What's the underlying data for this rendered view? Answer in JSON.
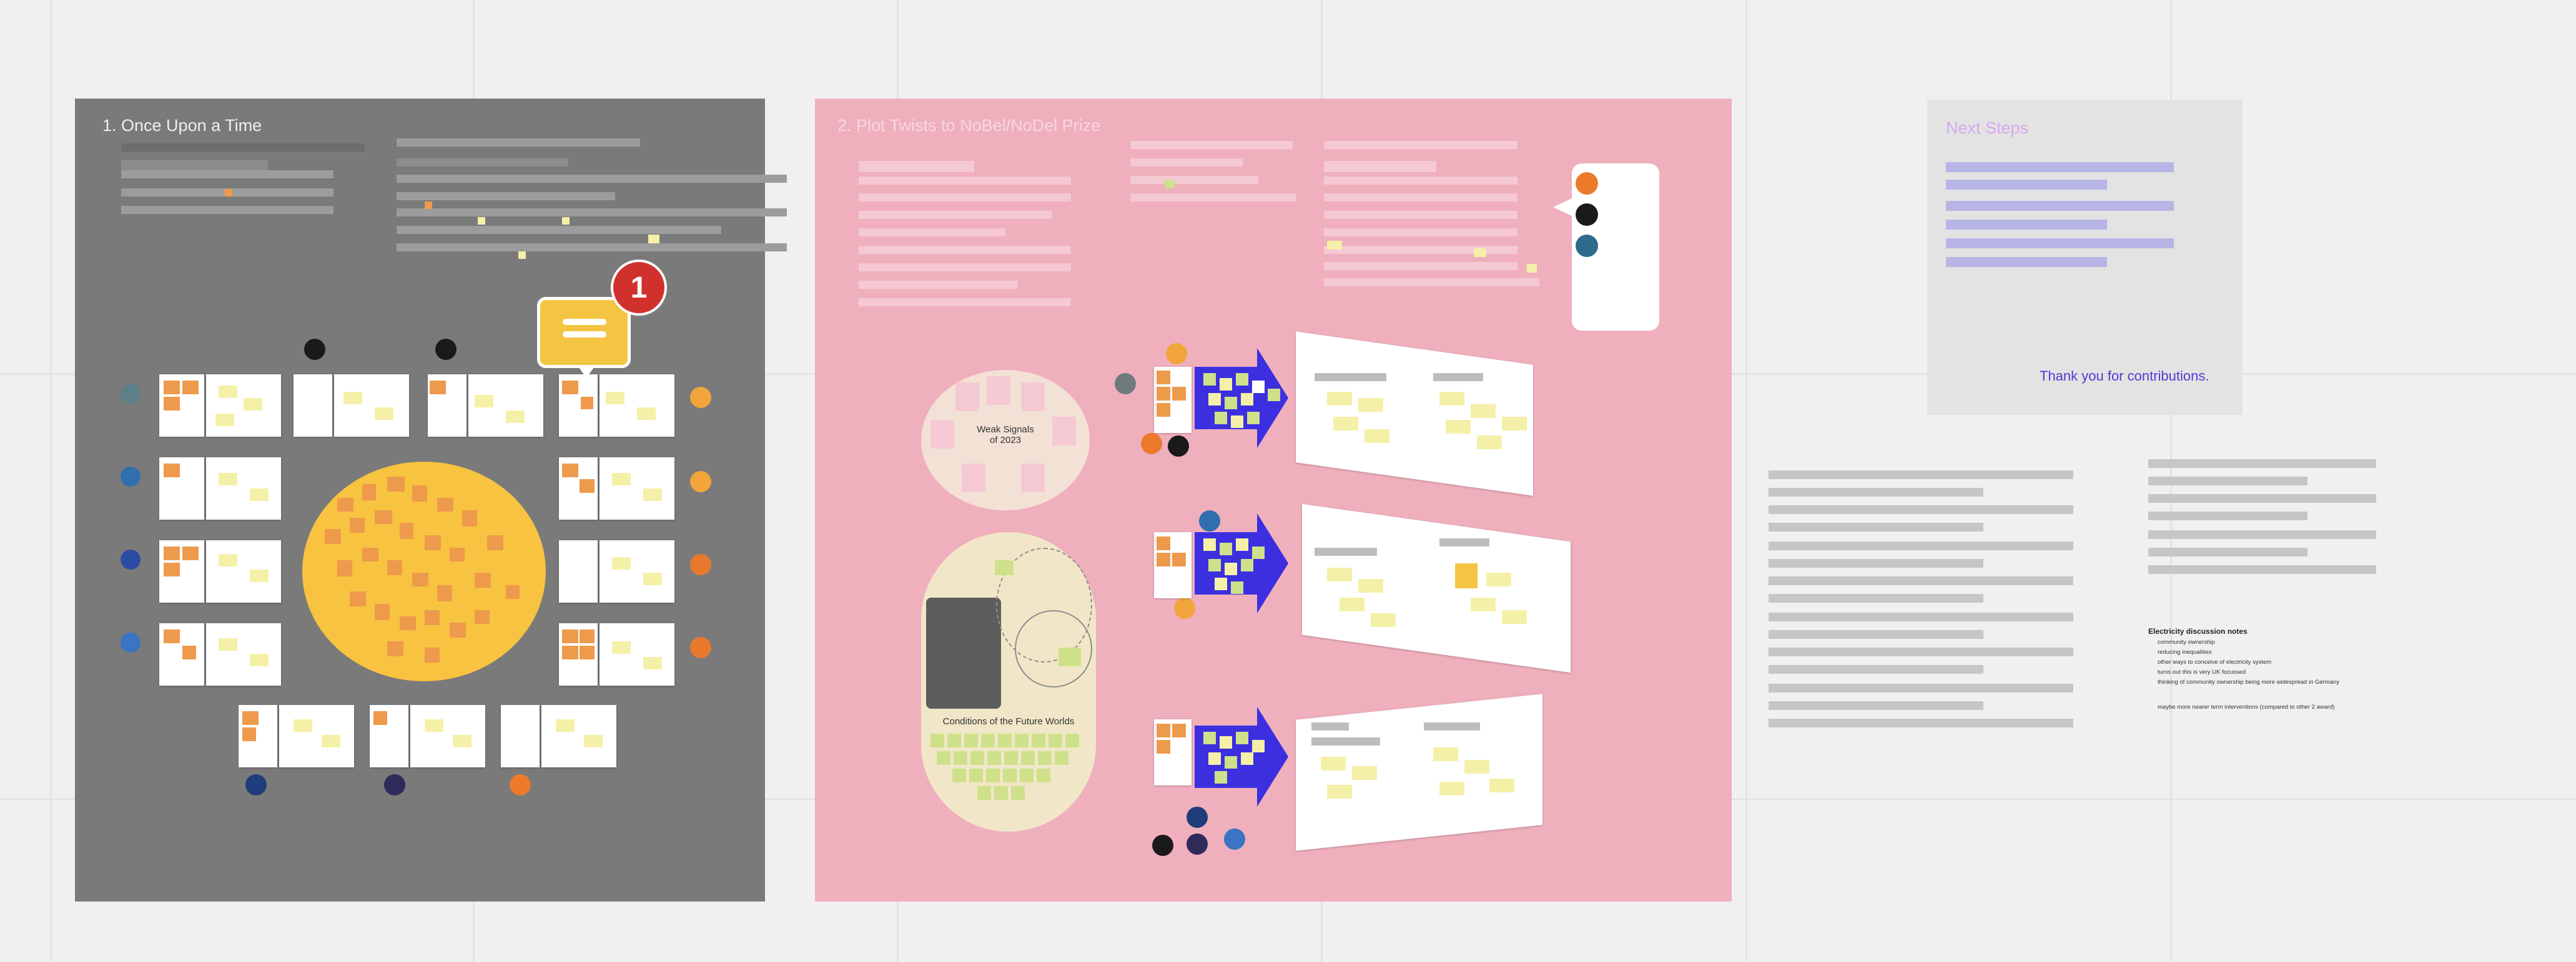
{
  "frames": {
    "once_upon_a_time": {
      "title": "1. Once Upon a Time"
    },
    "plot_twists": {
      "title": "2. Plot Twists to NoBel/NoDel Prize",
      "weak_signals_label": "Weak Signals\nof 2023",
      "conditions_label": "Conditions of the Future Worlds"
    },
    "next_steps": {
      "title": "Next Steps",
      "thanks": "Thank you for contributions."
    }
  },
  "comment": {
    "count": "1",
    "badge_color": "#d0312d",
    "bubble_color": "#f3c542"
  },
  "electricity_notes": {
    "title": "Electricity discussion notes",
    "items": [
      "community ownership",
      "reducing inequalities",
      "other ways to conceive of electricity system",
      "turns out this is very UK focussed",
      "thinking of community ownership being more widespread in Germany",
      "maybe more nearer term interventions (compared to other 2 award)"
    ]
  },
  "colors": {
    "board_bg": "#f0f0f0",
    "frame1_bg": "#7a7a7a",
    "frame2_bg": "#efafbd",
    "frame3_bg": "#e3e3e3",
    "next_steps_title": "#d6a7f0",
    "thanks_text": "#4a3cd4",
    "sun": "#f7c340",
    "sticky_orange": "#ee9a4c",
    "sticky_yellow": "#f5f0a8",
    "sticky_green": "#cfe08b",
    "arrow_blue": "#3b2fe0"
  }
}
